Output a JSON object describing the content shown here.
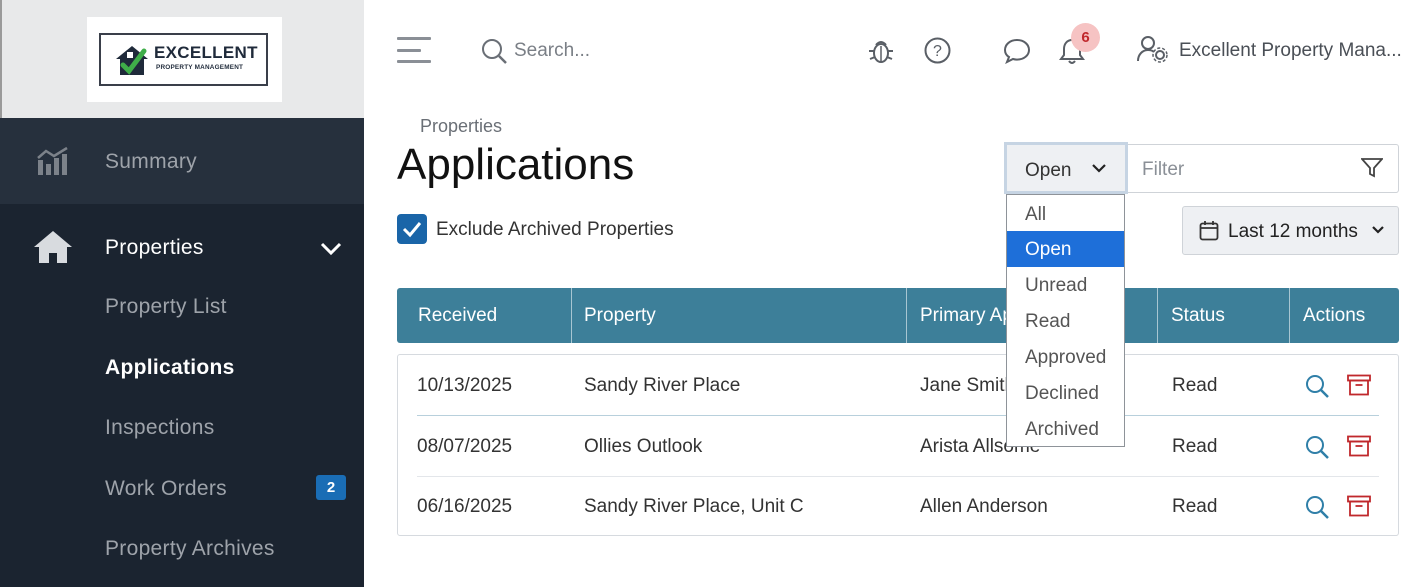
{
  "logo": {
    "line1": "EXCELLENT",
    "line2": "PROPERTY MANAGEMENT"
  },
  "sidebar": {
    "items": [
      {
        "label": "Summary",
        "icon": "chart-icon"
      },
      {
        "label": "Properties",
        "icon": "home-icon",
        "expanded": true
      },
      {
        "label": "Property List"
      },
      {
        "label": "Applications",
        "active": true
      },
      {
        "label": "Inspections"
      },
      {
        "label": "Work Orders",
        "badge": "2"
      },
      {
        "label": "Property Archives"
      }
    ]
  },
  "header": {
    "search_placeholder": "Search...",
    "notification_count": "6",
    "user_name": "Excellent Property Mana..."
  },
  "main": {
    "breadcrumb": "Properties",
    "title": "Applications",
    "status_filter": {
      "value": "Open",
      "options": [
        "All",
        "Open",
        "Unread",
        "Read",
        "Approved",
        "Declined",
        "Archived"
      ]
    },
    "filter_placeholder": "Filter",
    "exclude_archived_label": "Exclude Archived Properties",
    "exclude_archived_checked": true,
    "date_range": "Last 12 months"
  },
  "table": {
    "columns": [
      "Received",
      "Property",
      "Primary Ap",
      "Status",
      "Actions"
    ],
    "rows": [
      {
        "received": "10/13/2025",
        "property": "Sandy River Place",
        "applicant": "Jane Smith",
        "status": "Read"
      },
      {
        "received": "08/07/2025",
        "property": "Ollies Outlook",
        "applicant": "Arista Allsome",
        "status": "Read"
      },
      {
        "received": "06/16/2025",
        "property": "Sandy River Place, Unit C",
        "applicant": "Allen Anderson",
        "status": "Read"
      }
    ]
  },
  "colors": {
    "sidebar_bg": "#1b2430",
    "table_header": "#3d7f99",
    "accent_blue": "#1e6fd9",
    "archive_red": "#c0282c",
    "search_teal": "#2f7fa8"
  }
}
